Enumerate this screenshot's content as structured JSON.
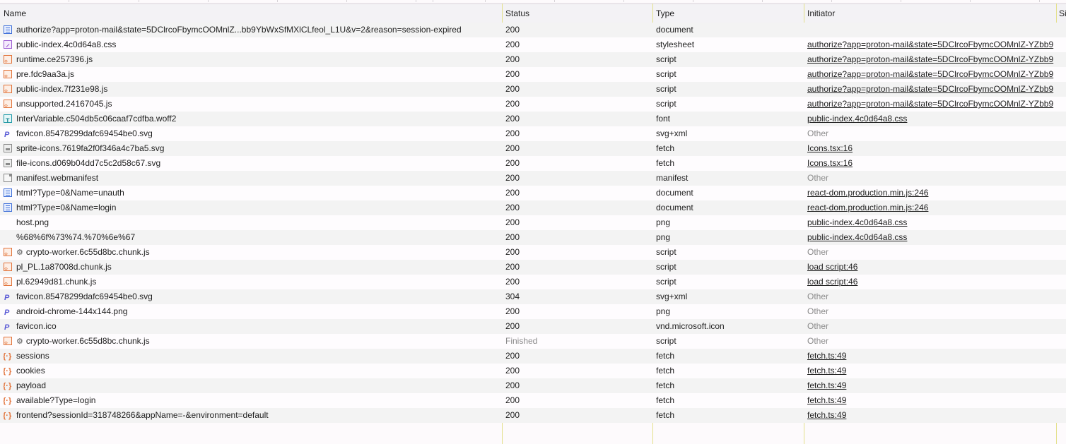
{
  "columns": {
    "name": "Name",
    "status": "Status",
    "type": "Type",
    "initiator": "Initiator",
    "size": "Si"
  },
  "rows": [
    {
      "icon": "document-icon",
      "gear": false,
      "name": "authorize?app=proton-mail&state=5DClrcoFbymcOOMnlZ...bb9YbWxSfMXlCLfeol_L1U&v=2&reason=session-expired",
      "status": "200",
      "type": "document",
      "initiator": "",
      "initiator_kind": "none"
    },
    {
      "icon": "stylesheet-icon",
      "gear": false,
      "name": "public-index.4c0d64a8.css",
      "status": "200",
      "type": "stylesheet",
      "initiator": "authorize?app=proton-mail&state=5DClrcoFbymcOOMnlZ-YZbb9",
      "initiator_kind": "link"
    },
    {
      "icon": "script-icon",
      "gear": false,
      "name": "runtime.ce257396.js",
      "status": "200",
      "type": "script",
      "initiator": "authorize?app=proton-mail&state=5DClrcoFbymcOOMnlZ-YZbb9",
      "initiator_kind": "link"
    },
    {
      "icon": "script-icon",
      "gear": false,
      "name": "pre.fdc9aa3a.js",
      "status": "200",
      "type": "script",
      "initiator": "authorize?app=proton-mail&state=5DClrcoFbymcOOMnlZ-YZbb9",
      "initiator_kind": "link"
    },
    {
      "icon": "script-icon",
      "gear": false,
      "name": "public-index.7f231e98.js",
      "status": "200",
      "type": "script",
      "initiator": "authorize?app=proton-mail&state=5DClrcoFbymcOOMnlZ-YZbb9",
      "initiator_kind": "link"
    },
    {
      "icon": "script-icon",
      "gear": false,
      "name": "unsupported.24167045.js",
      "status": "200",
      "type": "script",
      "initiator": "authorize?app=proton-mail&state=5DClrcoFbymcOOMnlZ-YZbb9",
      "initiator_kind": "link"
    },
    {
      "icon": "font-icon",
      "gear": false,
      "name": "InterVariable.c504db5c06caaf7cdfba.woff2",
      "status": "200",
      "type": "font",
      "initiator": "public-index.4c0d64a8.css",
      "initiator_kind": "link"
    },
    {
      "icon": "image-icon",
      "gear": false,
      "name": "favicon.85478299dafc69454be0.svg",
      "status": "200",
      "type": "svg+xml",
      "initiator": "Other",
      "initiator_kind": "other"
    },
    {
      "icon": "image-file-icon",
      "gear": false,
      "name": "sprite-icons.7619fa2f0f346a4c7ba5.svg",
      "status": "200",
      "type": "fetch",
      "initiator": "Icons.tsx:16",
      "initiator_kind": "link"
    },
    {
      "icon": "image-file-icon",
      "gear": false,
      "name": "file-icons.d069b04dd7c5c2d58c67.svg",
      "status": "200",
      "type": "fetch",
      "initiator": "Icons.tsx:16",
      "initiator_kind": "link"
    },
    {
      "icon": "manifest-icon",
      "gear": false,
      "name": "manifest.webmanifest",
      "status": "200",
      "type": "manifest",
      "initiator": "Other",
      "initiator_kind": "other"
    },
    {
      "icon": "document-icon",
      "gear": false,
      "name": "html?Type=0&Name=unauth",
      "status": "200",
      "type": "document",
      "initiator": "react-dom.production.min.js:246",
      "initiator_kind": "link"
    },
    {
      "icon": "document-icon",
      "gear": false,
      "name": "html?Type=0&Name=login",
      "status": "200",
      "type": "document",
      "initiator": "react-dom.production.min.js:246",
      "initiator_kind": "link"
    },
    {
      "icon": "none",
      "gear": false,
      "name": "host.png",
      "status": "200",
      "type": "png",
      "initiator": "public-index.4c0d64a8.css",
      "initiator_kind": "link"
    },
    {
      "icon": "none",
      "gear": false,
      "name": "%68%6f%73%74.%70%6e%67",
      "status": "200",
      "type": "png",
      "initiator": "public-index.4c0d64a8.css",
      "initiator_kind": "link"
    },
    {
      "icon": "script-icon",
      "gear": true,
      "name": "crypto-worker.6c55d8bc.chunk.js",
      "status": "200",
      "type": "script",
      "initiator": "Other",
      "initiator_kind": "other"
    },
    {
      "icon": "script-icon",
      "gear": false,
      "name": "pl_PL.1a87008d.chunk.js",
      "status": "200",
      "type": "script",
      "initiator": "load script:46",
      "initiator_kind": "link"
    },
    {
      "icon": "script-icon",
      "gear": false,
      "name": "pl.62949d81.chunk.js",
      "status": "200",
      "type": "script",
      "initiator": "load script:46",
      "initiator_kind": "link"
    },
    {
      "icon": "image-icon",
      "gear": false,
      "name": "favicon.85478299dafc69454be0.svg",
      "status": "304",
      "type": "svg+xml",
      "initiator": "Other",
      "initiator_kind": "other"
    },
    {
      "icon": "image-icon",
      "gear": false,
      "name": "android-chrome-144x144.png",
      "status": "200",
      "type": "png",
      "initiator": "Other",
      "initiator_kind": "other"
    },
    {
      "icon": "image-icon",
      "gear": false,
      "name": "favicon.ico",
      "status": "200",
      "type": "vnd.microsoft.icon",
      "initiator": "Other",
      "initiator_kind": "other"
    },
    {
      "icon": "script-icon",
      "gear": true,
      "name": "crypto-worker.6c55d8bc.chunk.js",
      "status": "Finished",
      "type": "script",
      "initiator": "Other",
      "initiator_kind": "other",
      "status_muted": true
    },
    {
      "icon": "fetch-icon",
      "gear": false,
      "name": "sessions",
      "status": "200",
      "type": "fetch",
      "initiator": "fetch.ts:49",
      "initiator_kind": "link"
    },
    {
      "icon": "fetch-icon",
      "gear": false,
      "name": "cookies",
      "status": "200",
      "type": "fetch",
      "initiator": "fetch.ts:49",
      "initiator_kind": "link"
    },
    {
      "icon": "fetch-icon",
      "gear": false,
      "name": "payload",
      "status": "200",
      "type": "fetch",
      "initiator": "fetch.ts:49",
      "initiator_kind": "link"
    },
    {
      "icon": "fetch-icon",
      "gear": false,
      "name": "available?Type=login",
      "status": "200",
      "type": "fetch",
      "initiator": "fetch.ts:49",
      "initiator_kind": "link"
    },
    {
      "icon": "fetch-icon",
      "gear": false,
      "name": "frontend?sessionId=318748266&appName=-&environment=default",
      "status": "200",
      "type": "fetch",
      "initiator": "fetch.ts:49",
      "initiator_kind": "link"
    }
  ]
}
